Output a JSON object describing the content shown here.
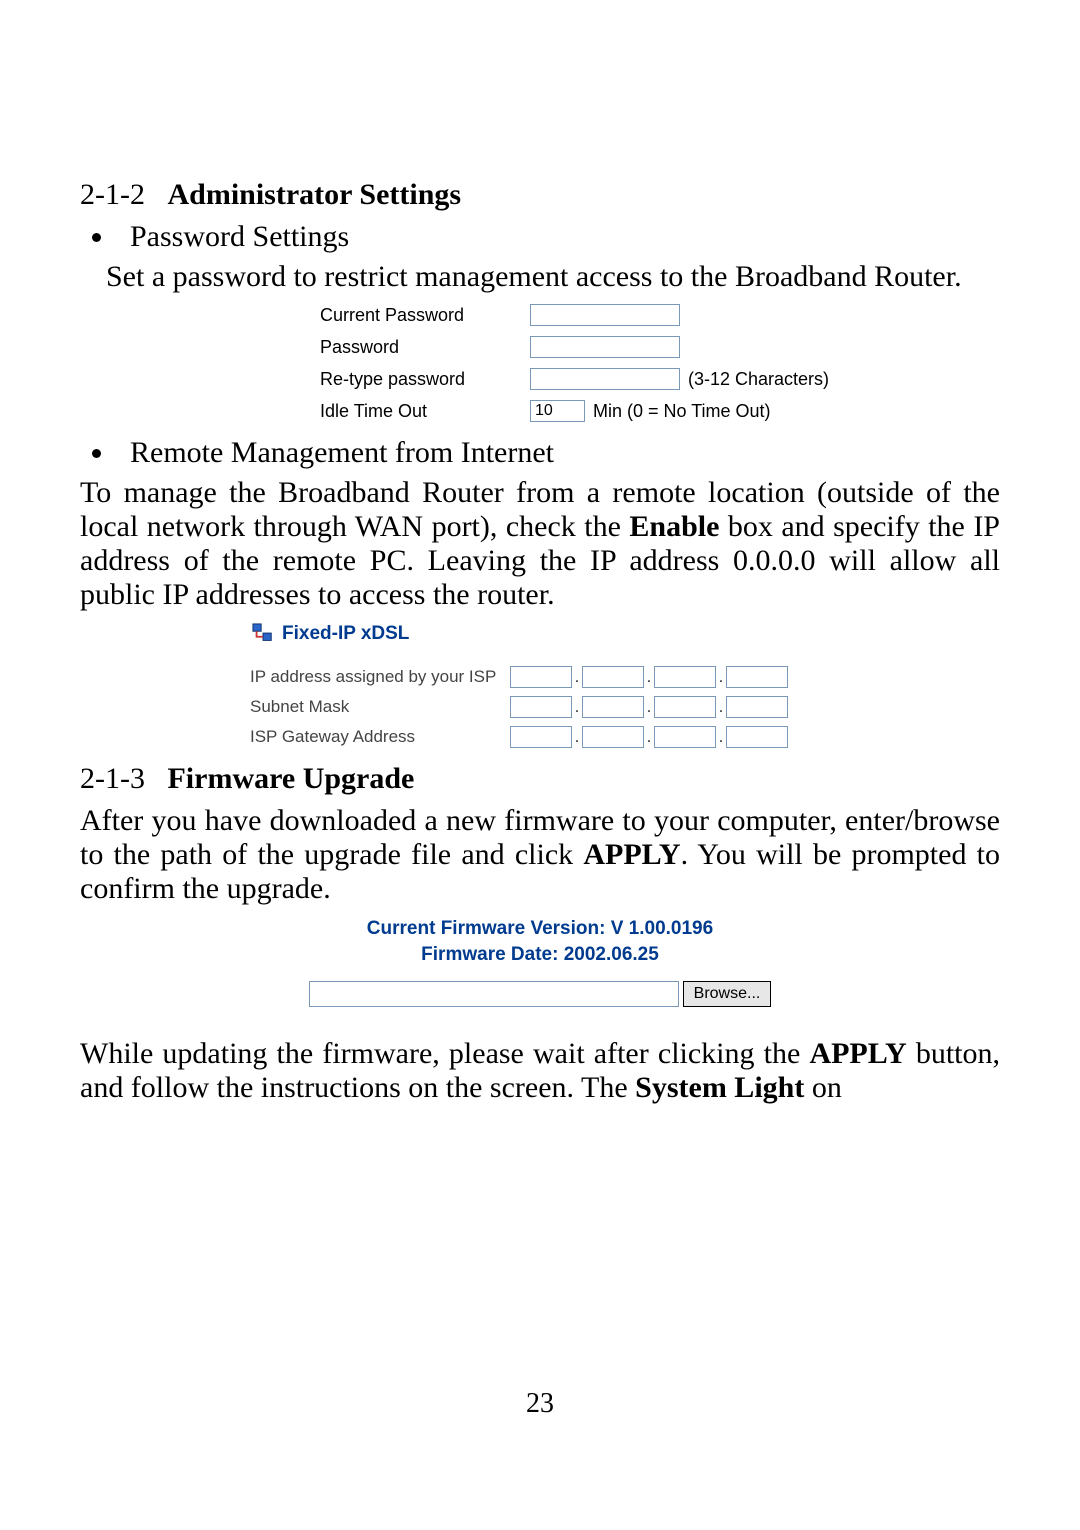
{
  "sections": {
    "admin": {
      "num": "2-1-2",
      "title": "Administrator Settings"
    },
    "fw": {
      "num": "2-1-3",
      "title": "Firmware Upgrade"
    }
  },
  "admin": {
    "bullet1": "Password Settings",
    "p1": "Set a password to restrict management access to the Broadband Router.",
    "shot": {
      "currentPassword": "Current Password",
      "password": "Password",
      "retype": "Re-type password",
      "retypeHint": "(3-12 Characters)",
      "idle": "Idle Time Out",
      "idleValue": "10",
      "idleHint": "Min (0 = No Time Out)"
    },
    "bullet2": "Remote Management from Internet",
    "p2a": "To manage the Broadband Router from a remote location (outside of the local network through WAN port), check the ",
    "p2bold": "Enable",
    "p2b": " box and specify the IP address of the remote PC. Leaving the IP address 0.0.0.0 will allow all public IP addresses to access the router.",
    "xdsl": {
      "title": "Fixed-IP xDSL",
      "row1": "IP address assigned by your ISP",
      "row2": "Subnet Mask",
      "row3": "ISP Gateway Address"
    }
  },
  "fw": {
    "p1a": "After you have downloaded a new firmware to your computer, enter/browse to the path of the upgrade file and click ",
    "p1bold": "APPLY",
    "p1b": ". You will be prompted to confirm the upgrade.",
    "shot": {
      "line1": "Current Firmware Version: V 1.00.0196",
      "line2": "Firmware Date:  2002.06.25",
      "browse": "Browse..."
    },
    "p2a": "While updating the firmware, please wait after clicking the ",
    "p2bold1": "APPLY",
    "p2b": " button, and follow the instructions on the screen. The ",
    "p2bold2": "System Light",
    "p2c": " on"
  },
  "pageNumber": "23"
}
